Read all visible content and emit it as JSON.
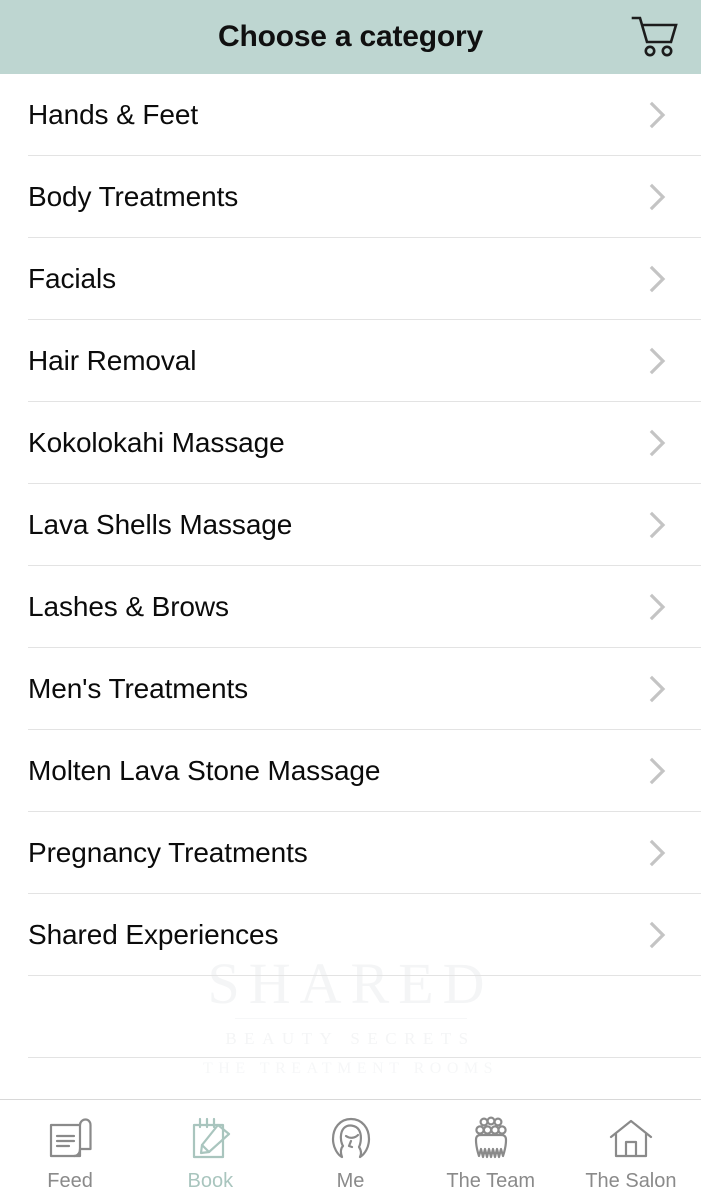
{
  "header": {
    "title": "Choose a category",
    "background_color": "#bed6d1",
    "cart_icon": "shopping-cart-icon"
  },
  "list": {
    "chevron_icon": "chevron-right-icon",
    "items": [
      {
        "label": "Hands & Feet"
      },
      {
        "label": "Body Treatments"
      },
      {
        "label": "Facials"
      },
      {
        "label": "Hair Removal"
      },
      {
        "label": "Kokolokahi Massage"
      },
      {
        "label": "Lava Shells Massage"
      },
      {
        "label": "Lashes & Brows"
      },
      {
        "label": "Men's Treatments"
      },
      {
        "label": "Molten Lava Stone Massage"
      },
      {
        "label": "Pregnancy Treatments"
      },
      {
        "label": "Shared Experiences"
      }
    ]
  },
  "watermark": {
    "main": "SHARED",
    "line1": "BEAUTY SECRETS",
    "line2": "THE TREATMENT ROOMS"
  },
  "tabbar": {
    "active_color": "#a9c5be",
    "inactive_color": "#8a8a8a",
    "tabs": [
      {
        "label": "Feed",
        "icon": "feed-scroll-icon",
        "active": false
      },
      {
        "label": "Book",
        "icon": "notepad-pencil-icon",
        "active": true
      },
      {
        "label": "Me",
        "icon": "person-head-icon",
        "active": false
      },
      {
        "label": "The Team",
        "icon": "group-people-icon",
        "active": false
      },
      {
        "label": "The Salon",
        "icon": "house-icon",
        "active": false
      }
    ]
  }
}
